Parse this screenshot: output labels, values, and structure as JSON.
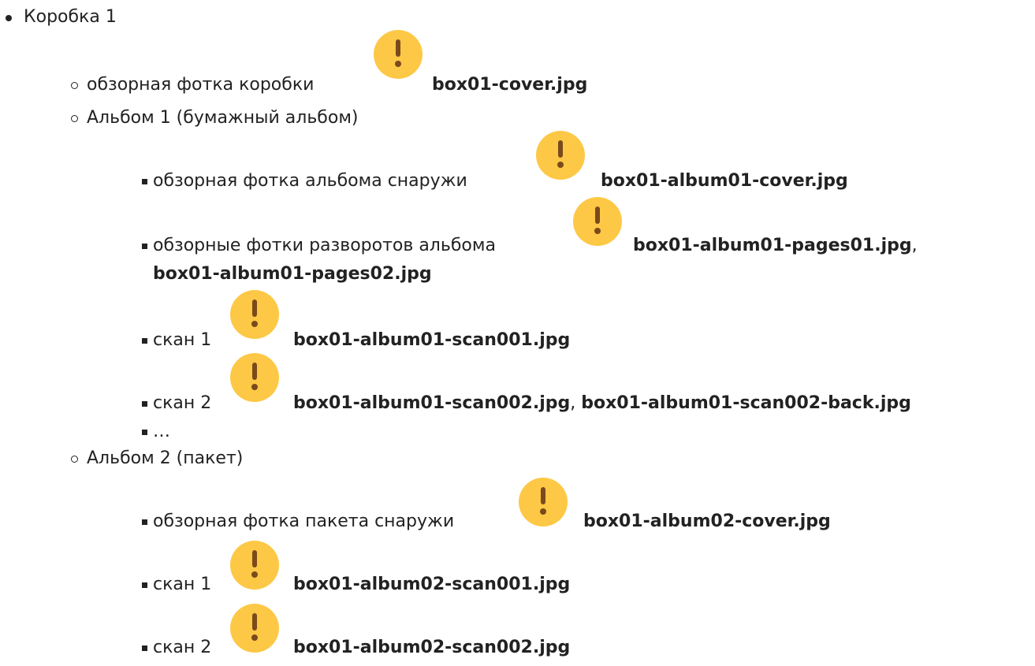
{
  "box": {
    "label": "Коробка 1"
  },
  "box_cover": {
    "text": "обзорная фотка коробки",
    "file": "box01-cover.jpg"
  },
  "album1": {
    "label": "Альбом 1 (бумажный альбом)"
  },
  "album1_cover": {
    "text": "обзорная фотка альбома снаружи",
    "file": "box01-album01-cover.jpg"
  },
  "album1_pages": {
    "text": "обзорные фотки разворотов альбома",
    "file1": "box01-album01-pages01.jpg",
    "sep": ",",
    "file2": "box01-album01-pages02.jpg"
  },
  "album1_scan1": {
    "text": "скан 1",
    "file": "box01-album01-scan001.jpg"
  },
  "album1_scan2": {
    "text": "скан 2",
    "file1": "box01-album01-scan002.jpg",
    "sep": ",",
    "file2": "box01-album01-scan002-back.jpg"
  },
  "album1_more": {
    "text": "…"
  },
  "album2": {
    "label": "Альбом 2 (пакет)"
  },
  "album2_cover": {
    "text": "обзорная фотка пакета снаружи",
    "file": "box01-album02-cover.jpg"
  },
  "album2_scan1": {
    "text": "скан 1",
    "file": "box01-album02-scan001.jpg"
  },
  "album2_scan2": {
    "text": "скан 2",
    "file": "box01-album02-scan002.jpg"
  },
  "icon": {
    "name": "warning-icon",
    "color": "#fdc845",
    "glyph_color": "#7a4a1c"
  }
}
